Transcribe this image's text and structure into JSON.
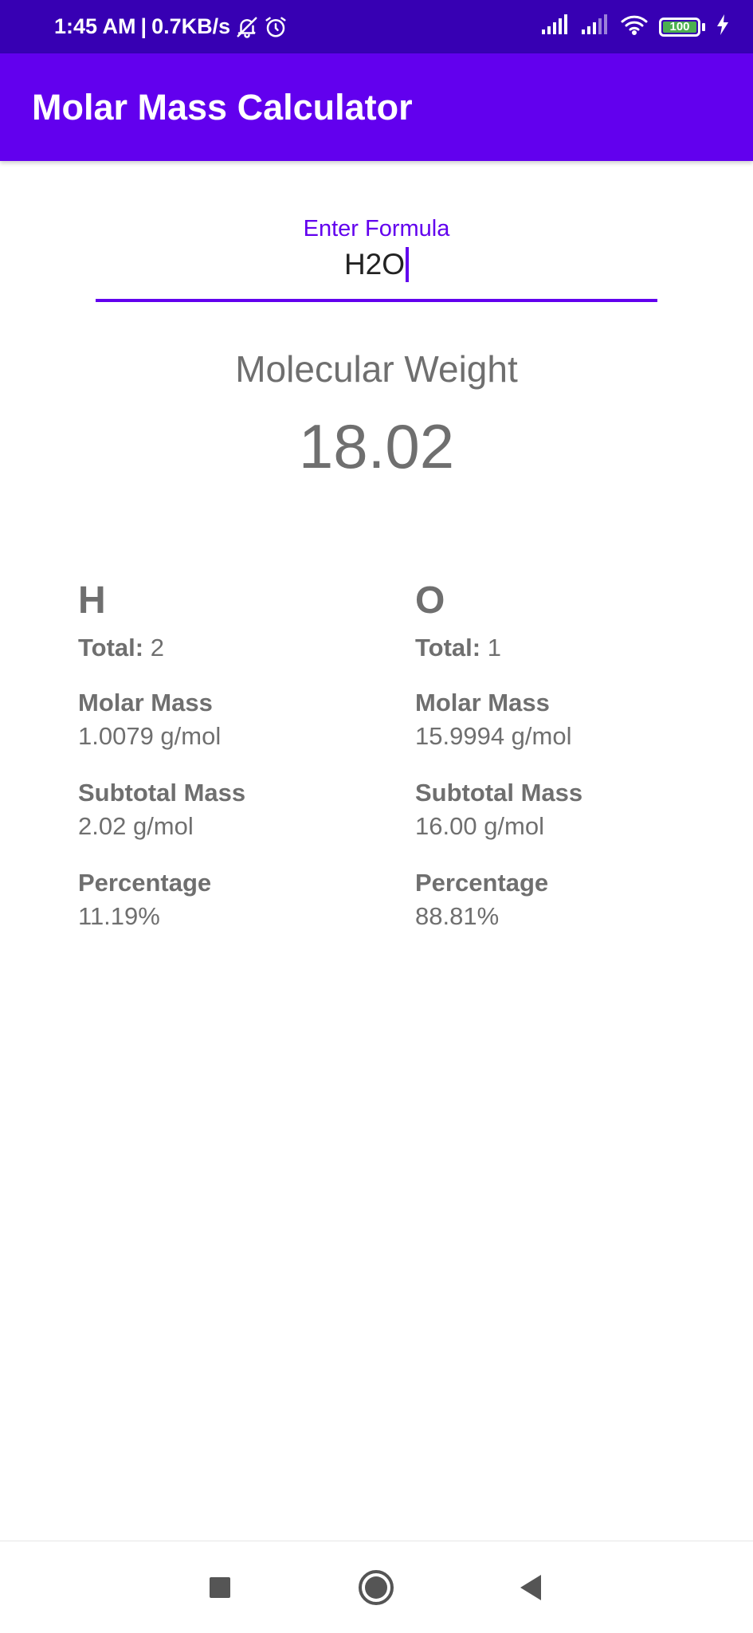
{
  "status_bar": {
    "time": "1:45 AM",
    "network_speed": "0.7KB/s",
    "battery": "100",
    "icons": [
      "bell-off-icon",
      "alarm-icon",
      "signal-icon",
      "signal-icon",
      "wifi-icon",
      "battery-icon",
      "charging-icon"
    ]
  },
  "app_bar": {
    "title": "Molar Mass Calculator"
  },
  "formula": {
    "label": "Enter Formula",
    "value": "H2O"
  },
  "result": {
    "heading": "Molecular Weight",
    "value": "18.02"
  },
  "elements": [
    {
      "symbol": "H",
      "total_label": "Total:",
      "total": "2",
      "molar_mass_label": "Molar Mass",
      "molar_mass": "1.0079 g/mol",
      "subtotal_label": "Subtotal Mass",
      "subtotal": "2.02 g/mol",
      "percentage_label": "Percentage",
      "percentage": "11.19%"
    },
    {
      "symbol": "O",
      "total_label": "Total:",
      "total": "1",
      "molar_mass_label": "Molar Mass",
      "molar_mass": "15.9994 g/mol",
      "subtotal_label": "Subtotal Mass",
      "subtotal": "16.00 g/mol",
      "percentage_label": "Percentage",
      "percentage": "88.81%"
    }
  ],
  "nav_bar": {
    "icons": [
      "recents-icon",
      "home-icon",
      "back-icon"
    ]
  },
  "colors": {
    "status_bar": "#3700b3",
    "app_bar": "#6200ee",
    "accent": "#6200ee",
    "text_secondary": "#6f6f6f",
    "battery_fill": "#4caf50"
  }
}
